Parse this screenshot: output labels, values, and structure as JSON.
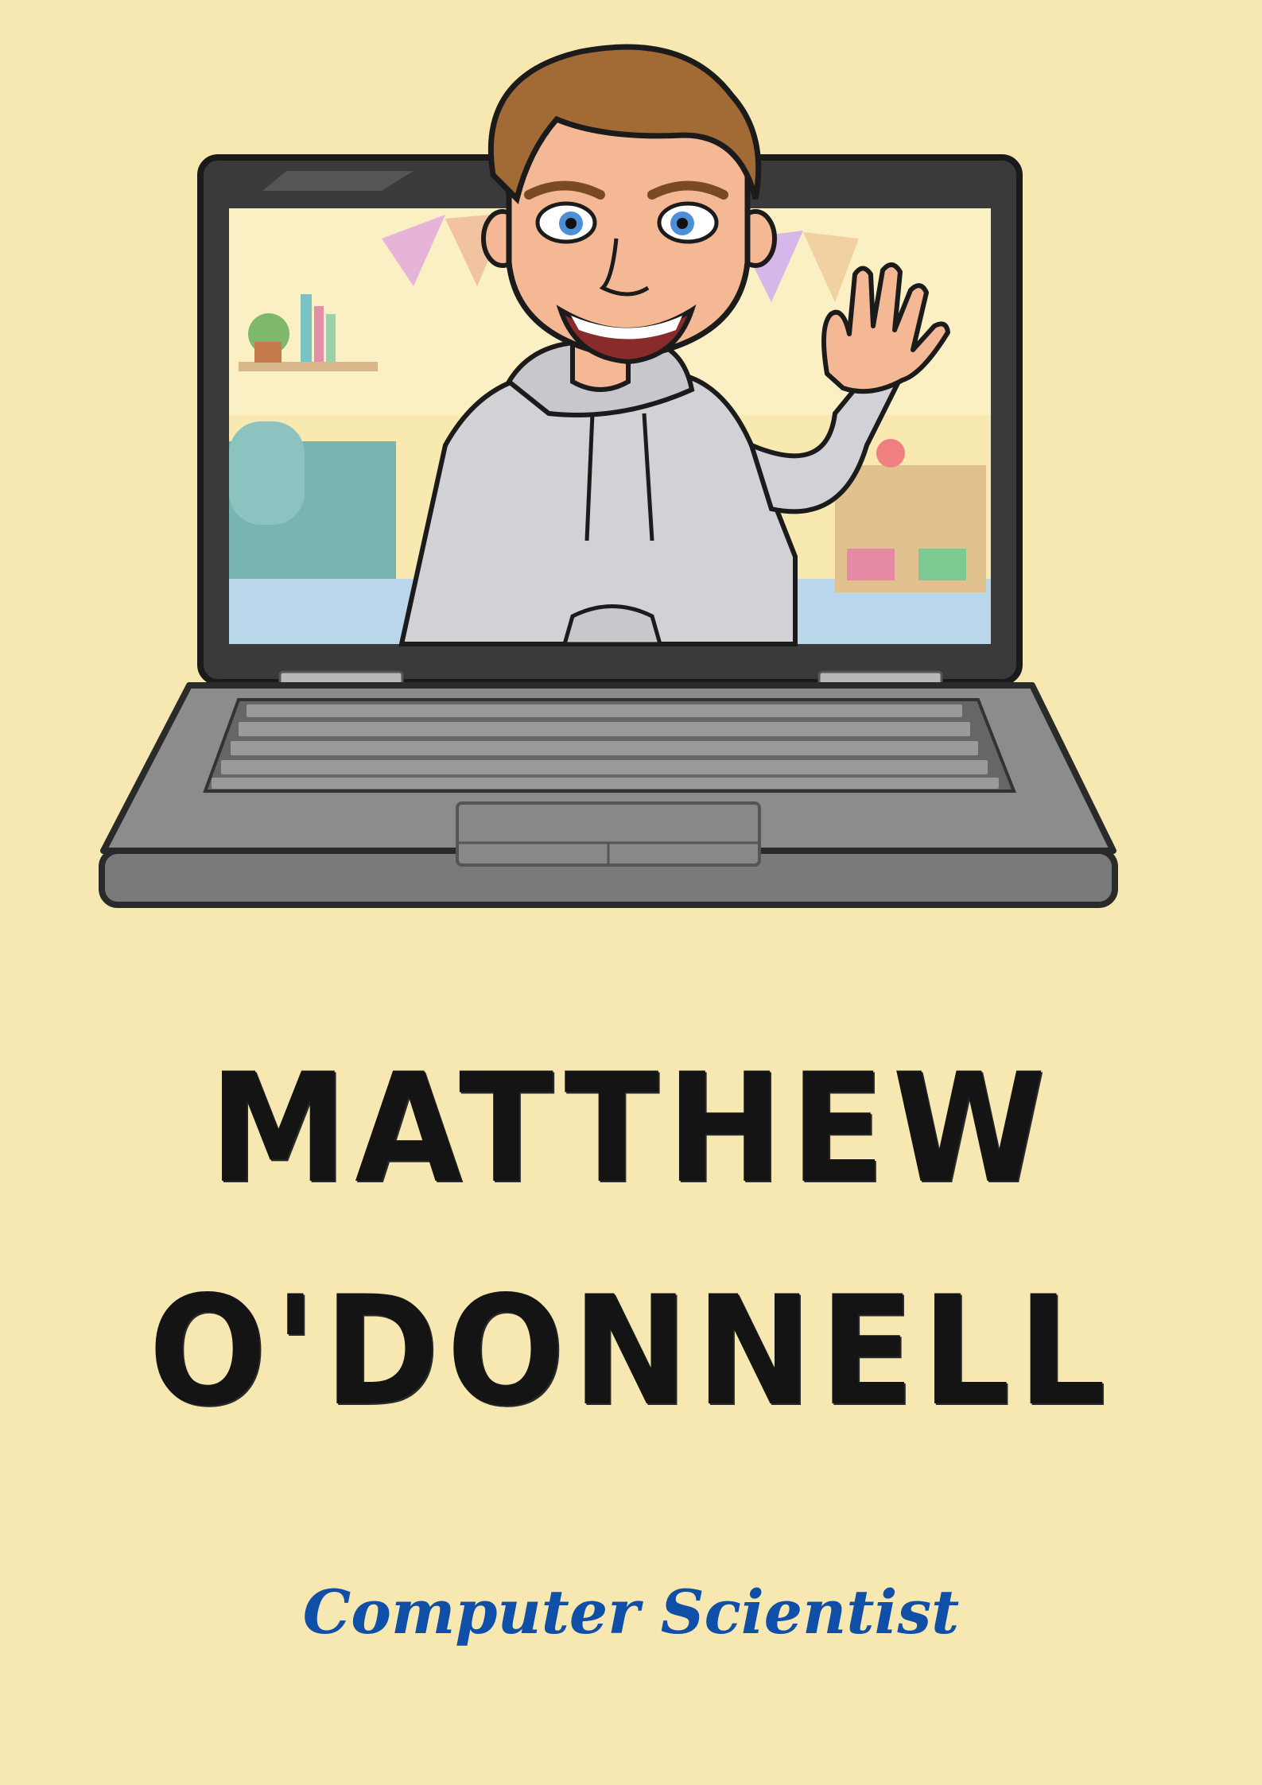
{
  "profile": {
    "first_name": "MATTHEW",
    "last_name": "O'DONNELL",
    "title": "Computer Scientist"
  },
  "colors": {
    "background": "#f6e8b0",
    "name_text": "#141414",
    "title_text": "#0f4fa8"
  },
  "illustration": {
    "subject": "cartoon avatar waving from a laptop screen",
    "icons": [
      "laptop-icon",
      "avatar",
      "waving-hand-icon"
    ]
  }
}
